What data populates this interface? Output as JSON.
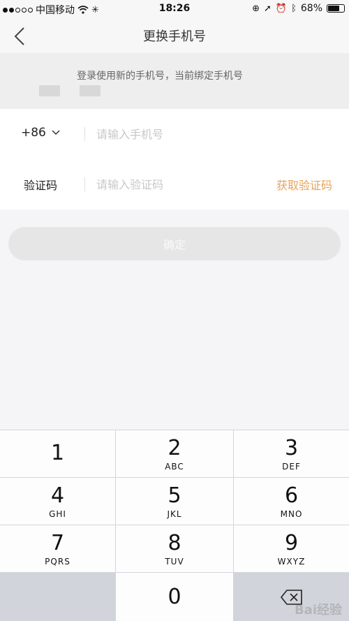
{
  "status_bar": {
    "carrier": "中国移动",
    "time": "18:26",
    "battery": "68%",
    "battery_level": 0.68
  },
  "nav": {
    "title": "更换手机号"
  },
  "notice": {
    "text": "登录使用新的手机号，当前绑定手机号"
  },
  "form": {
    "country_code": "+86",
    "phone_placeholder": "请输入手机号",
    "code_label": "验证码",
    "code_placeholder": "请输入验证码",
    "get_code_label": "获取验证码"
  },
  "confirm_label": "确定",
  "keypad": {
    "keys": [
      {
        "num": "1",
        "letters": ""
      },
      {
        "num": "2",
        "letters": "ABC"
      },
      {
        "num": "3",
        "letters": "DEF"
      },
      {
        "num": "4",
        "letters": "GHI"
      },
      {
        "num": "5",
        "letters": "JKL"
      },
      {
        "num": "6",
        "letters": "MNO"
      },
      {
        "num": "7",
        "letters": "PQRS"
      },
      {
        "num": "8",
        "letters": "TUV"
      },
      {
        "num": "9",
        "letters": "WXYZ"
      },
      {
        "num": "0",
        "letters": ""
      }
    ]
  },
  "watermark": "Bai经验",
  "colors": {
    "accent": "#e8a25a",
    "keyboard_bg": "#d1d5db",
    "disabled_button": "#e6e6e6"
  }
}
